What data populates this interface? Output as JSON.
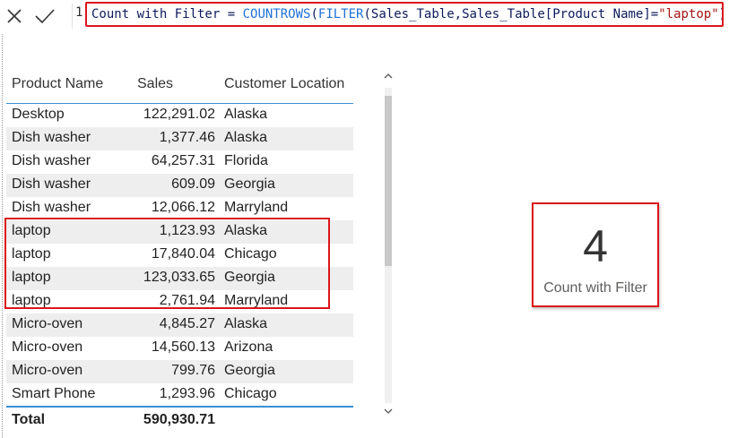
{
  "formula_bar": {
    "line_number": "1",
    "tokens": {
      "measure": "Count with Filter",
      "equals": " = ",
      "func1": "COUNTROWS",
      "paren1": "(",
      "func2": "FILTER",
      "paren2": "(",
      "table": "Sales_Table",
      "comma": ",",
      "column": "Sales_Table[Product Name]",
      "eq": "=",
      "string": "\"laptop\"",
      "close": "))"
    },
    "cancel_icon": "close-icon",
    "commit_icon": "check-icon"
  },
  "table": {
    "headers": {
      "product": "Product Name",
      "sales": "Sales",
      "location": "Customer Location"
    },
    "rows": [
      {
        "product": "Desktop",
        "sales": "122,291.02",
        "location": "Alaska"
      },
      {
        "product": "Dish washer",
        "sales": "1,377.46",
        "location": "Alaska"
      },
      {
        "product": "Dish washer",
        "sales": "64,257.31",
        "location": "Florida"
      },
      {
        "product": "Dish washer",
        "sales": "609.09",
        "location": "Georgia"
      },
      {
        "product": "Dish washer",
        "sales": "12,066.12",
        "location": "Marryland"
      },
      {
        "product": "laptop",
        "sales": "1,123.93",
        "location": "Alaska"
      },
      {
        "product": "laptop",
        "sales": "17,840.04",
        "location": "Chicago"
      },
      {
        "product": "laptop",
        "sales": "123,033.65",
        "location": "Georgia"
      },
      {
        "product": "laptop",
        "sales": "2,761.94",
        "location": "Marryland"
      },
      {
        "product": "Micro-oven",
        "sales": "4,845.27",
        "location": "Alaska"
      },
      {
        "product": "Micro-oven",
        "sales": "14,560.13",
        "location": "Arizona"
      },
      {
        "product": "Micro-oven",
        "sales": "799.76",
        "location": "Georgia"
      },
      {
        "product": "Smart Phone",
        "sales": "1,293.96",
        "location": "Chicago"
      }
    ],
    "total": {
      "label": "Total",
      "sales": "590,930.71"
    },
    "scroll_up_icon": "chevron-up-icon",
    "scroll_down_icon": "chevron-down-icon"
  },
  "card": {
    "value": "4",
    "label": "Count with Filter"
  },
  "colors": {
    "highlight": "#d9161c",
    "header_rule": "#3a8fd9",
    "dax_function": "#1e71d6",
    "dax_string": "#a31515"
  }
}
